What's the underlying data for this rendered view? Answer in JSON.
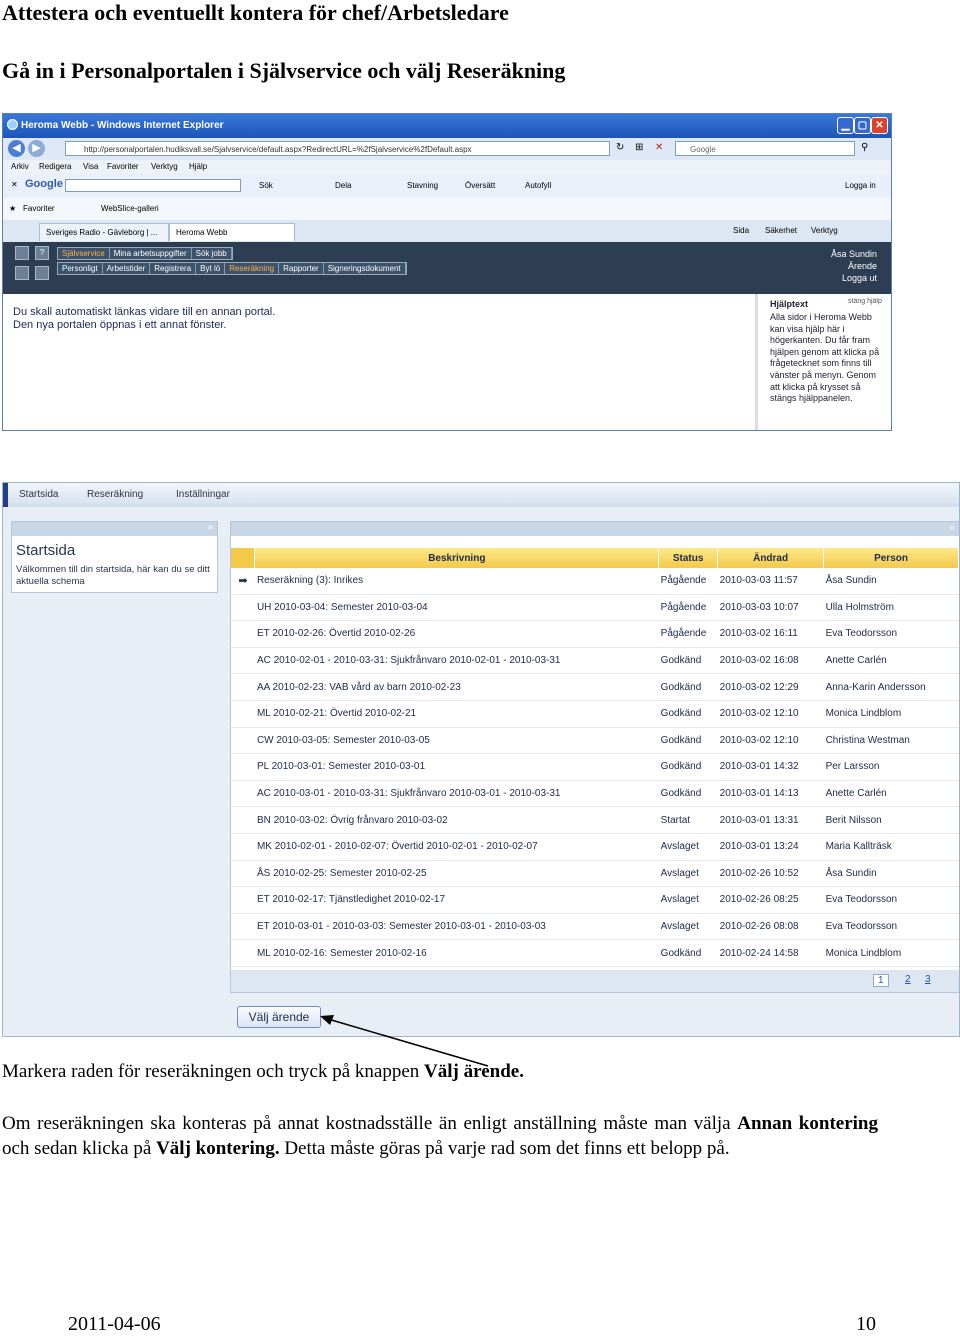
{
  "heading1": "Attestera och eventuellt kontera för chef/Arbetsledare",
  "heading2": "Gå in i Personalportalen i Självservice och välj Reseräkning",
  "ie": {
    "title": "Heroma Webb - Windows Internet Explorer",
    "address": "http://personalportalen.hudiksvall.se/Sjalvservice/default.aspx?RedirectURL=%2fSjalvservice%2fDefault.aspx",
    "search_placeholder": "Google",
    "menu": [
      "Arkiv",
      "Redigera",
      "Visa",
      "Favoriter",
      "Verktyg",
      "Hjälp"
    ],
    "google_toolbar": {
      "logo": "Google",
      "items": [
        "Sök",
        "Dela",
        "Stavning",
        "Översätt",
        "Autofyll",
        "Logga in"
      ]
    },
    "favorites": {
      "label": "Favoriter",
      "webslice": "WebSlice-galleri"
    },
    "tabs": [
      "Sveriges Radio - Gävleborg | ...",
      "Heroma Webb"
    ],
    "tab_tools": [
      "Sida",
      "Säkerhet",
      "Verktyg"
    ],
    "portal": {
      "menu": [
        "Självservice",
        "Mina arbetsuppgifter",
        "Sök jobb"
      ],
      "submenu": [
        "Personligt",
        "Arbetstider",
        "Registrera",
        "Byt lö",
        "Reseräkning",
        "Rapporter",
        "Signeringsdokument"
      ],
      "user_name": "Åsa Sundin",
      "user_role": "Ärende",
      "logout": "Logga ut"
    },
    "message_line1": "Du skall automatiskt länkas vidare till en annan portal.",
    "message_line2": "Den nya portalen öppnas i ett annat fönster.",
    "help": {
      "title": "Hjälptext",
      "close": "stäng hjälp",
      "body": "Alla sidor i Heroma Webb kan visa hjälp här i högerkanten. Du får fram hjälpen genom att klicka på frågetecknet som finns till vänster på menyn. Genom att klicka på krysset så stängs hjälppanelen."
    }
  },
  "app": {
    "tabs": [
      "Startsida",
      "Reseräkning",
      "Inställningar"
    ],
    "start_title": "Startsida",
    "start_desc": "Välkommen till din startsida, här kan du se ditt aktuella schema",
    "columns": [
      "Beskrivning",
      "Status",
      "Ändrad",
      "Person"
    ],
    "rows": [
      {
        "mark": "➡",
        "desc": "Reseräkning (3): Inrikes",
        "status": "Pågående",
        "changed": "2010-03-03 11:57",
        "person": "Åsa Sundin"
      },
      {
        "mark": "",
        "desc": "UH 2010-03-04: Semester 2010-03-04",
        "status": "Pågående",
        "changed": "2010-03-03 10:07",
        "person": "Ulla Holmström"
      },
      {
        "mark": "",
        "desc": "ET 2010-02-26: Övertid 2010-02-26",
        "status": "Pågående",
        "changed": "2010-03-02 16:11",
        "person": "Eva Teodorsson"
      },
      {
        "mark": "",
        "desc": "AC 2010-02-01 - 2010-03-31: Sjukfrånvaro 2010-02-01 - 2010-03-31",
        "status": "Godkänd",
        "changed": "2010-03-02 16:08",
        "person": "Anette Carlén"
      },
      {
        "mark": "",
        "desc": "AA 2010-02-23: VAB vård av barn 2010-02-23",
        "status": "Godkänd",
        "changed": "2010-03-02 12:29",
        "person": "Anna-Karin Andersson"
      },
      {
        "mark": "",
        "desc": "ML 2010-02-21: Övertid 2010-02-21",
        "status": "Godkänd",
        "changed": "2010-03-02 12:10",
        "person": "Monica Lindblom"
      },
      {
        "mark": "",
        "desc": "CW 2010-03-05: Semester 2010-03-05",
        "status": "Godkänd",
        "changed": "2010-03-02 12:10",
        "person": "Christina Westman"
      },
      {
        "mark": "",
        "desc": "PL 2010-03-01: Semester 2010-03-01",
        "status": "Godkänd",
        "changed": "2010-03-01 14:32",
        "person": "Per Larsson"
      },
      {
        "mark": "",
        "desc": "AC 2010-03-01 - 2010-03-31: Sjukfrånvaro 2010-03-01 - 2010-03-31",
        "status": "Godkänd",
        "changed": "2010-03-01 14:13",
        "person": "Anette Carlén"
      },
      {
        "mark": "",
        "desc": "BN 2010-03-02: Övrig frånvaro 2010-03-02",
        "status": "Startat",
        "changed": "2010-03-01 13:31",
        "person": "Berit Nilsson"
      },
      {
        "mark": "",
        "desc": "MK 2010-02-01 - 2010-02-07: Övertid 2010-02-01 - 2010-02-07",
        "status": "Avslaget",
        "changed": "2010-03-01 13:24",
        "person": "Maria Kallträsk"
      },
      {
        "mark": "",
        "desc": "ÅS 2010-02-25: Semester 2010-02-25",
        "status": "Avslaget",
        "changed": "2010-02-26 10:52",
        "person": "Åsa Sundin"
      },
      {
        "mark": "",
        "desc": "ET 2010-02-17: Tjänstledighet 2010-02-17",
        "status": "Avslaget",
        "changed": "2010-02-26 08:25",
        "person": "Eva Teodorsson"
      },
      {
        "mark": "",
        "desc": "ET 2010-03-01 - 2010-03-03: Semester 2010-03-01 - 2010-03-03",
        "status": "Avslaget",
        "changed": "2010-02-26 08:08",
        "person": "Eva Teodorsson"
      },
      {
        "mark": "",
        "desc": "ML 2010-02-16: Semester 2010-02-16",
        "status": "Godkänd",
        "changed": "2010-02-24 14:58",
        "person": "Monica Lindblom"
      }
    ],
    "pages": [
      "1",
      "2",
      "3"
    ],
    "select_button": "Välj ärende"
  },
  "caption": {
    "text": "Markera raden för reseräkningen och tryck på knappen ",
    "bold": "Välj ärende."
  },
  "paragraph": {
    "p1": "Om reseräkningen ska konteras på annat kostnadsställe än enligt anställning måste man välja ",
    "b1": "Annan kontering",
    "p2": " och sedan klicka på ",
    "b2": "Välj kontering.",
    "p3": " Detta måste göras på varje rad som det finns ett belopp på."
  },
  "footer": {
    "date": "2011-04-06",
    "page": "10"
  }
}
